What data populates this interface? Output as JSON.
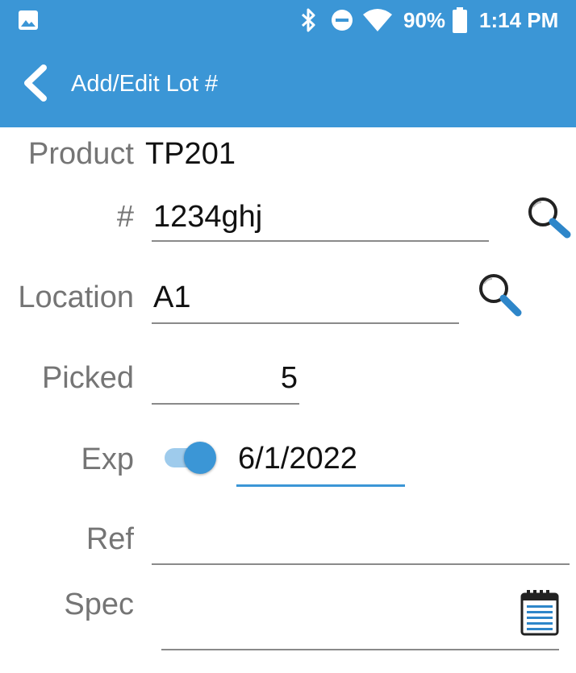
{
  "status_bar": {
    "battery_percent": "90%",
    "time": "1:14 PM",
    "icons": [
      "image-icon",
      "bluetooth-icon",
      "do-not-disturb-icon",
      "wifi-icon",
      "battery-icon"
    ]
  },
  "app_bar": {
    "title": "Add/Edit Lot #",
    "back_icon": "chevron-left-icon"
  },
  "form": {
    "product": {
      "label": "Product",
      "value": "TP201"
    },
    "lot": {
      "label": "#",
      "value": "1234ghj",
      "icon": "search-icon"
    },
    "location": {
      "label": "Location",
      "value": "A1",
      "icon": "search-icon"
    },
    "picked": {
      "label": "Picked",
      "value": "5"
    },
    "exp": {
      "label": "Exp",
      "value": "6/1/2022",
      "toggle_on": true
    },
    "ref": {
      "label": "Ref",
      "value": ""
    },
    "spec": {
      "label": "Spec",
      "value": "",
      "icon": "notepad-icon"
    }
  },
  "colors": {
    "accent": "#3b96d6",
    "label": "#757575",
    "text": "#111111",
    "underline": "#8a8a8a"
  }
}
